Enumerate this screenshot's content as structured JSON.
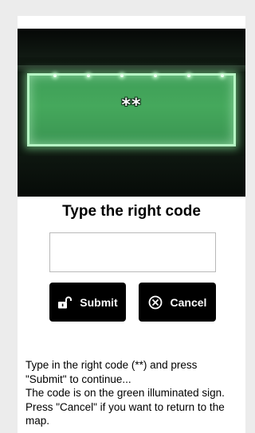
{
  "scene": {
    "code_on_sign": "**",
    "colors": {
      "sign_green": "#45a85c",
      "sign_border": "#b6f5c4",
      "background_dark": "#0b100c"
    }
  },
  "title": "Type the right code",
  "code_input": {
    "value": "",
    "placeholder": ""
  },
  "buttons": {
    "submit": {
      "label": "Submit",
      "icon": "unlock-icon"
    },
    "cancel": {
      "label": "Cancel",
      "icon": "cancel-circle-icon"
    }
  },
  "instructions": {
    "line1": "Type in the right code (**) and press \"Submit\" to continue...",
    "line2": "The code is on the green illuminated sign.",
    "line3": "Press \"Cancel\" if you want to return to the map."
  },
  "colors": {
    "button_bg": "#000000",
    "button_text": "#ffffff",
    "page_bg": "#ececec",
    "card_bg": "#ffffff"
  }
}
